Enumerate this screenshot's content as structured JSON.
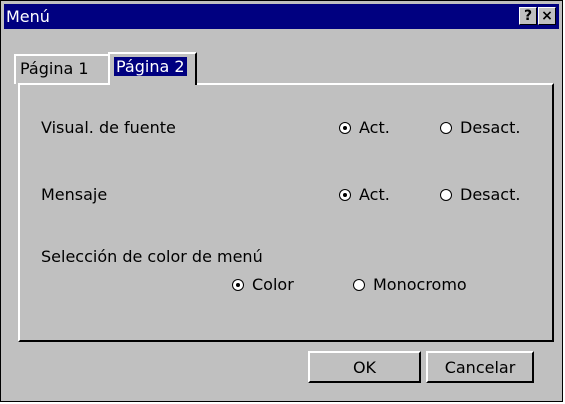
{
  "window": {
    "title": "Menú",
    "help_label": "?",
    "close_label": "×"
  },
  "tabs": [
    {
      "label": "Página 1",
      "active": false
    },
    {
      "label": "Página 2",
      "active": true
    }
  ],
  "settings": {
    "source_display": {
      "label": "Visual. de fuente",
      "options": [
        "Act.",
        "Desact."
      ],
      "selected": "Act."
    },
    "message": {
      "label": "Mensaje",
      "options": [
        "Act.",
        "Desact."
      ],
      "selected": "Act."
    },
    "menu_color": {
      "label": "Selección de color de menú",
      "options": [
        "Color",
        "Monocromo"
      ],
      "selected": "Color"
    }
  },
  "buttons": {
    "ok": "OK",
    "cancel": "Cancelar"
  }
}
